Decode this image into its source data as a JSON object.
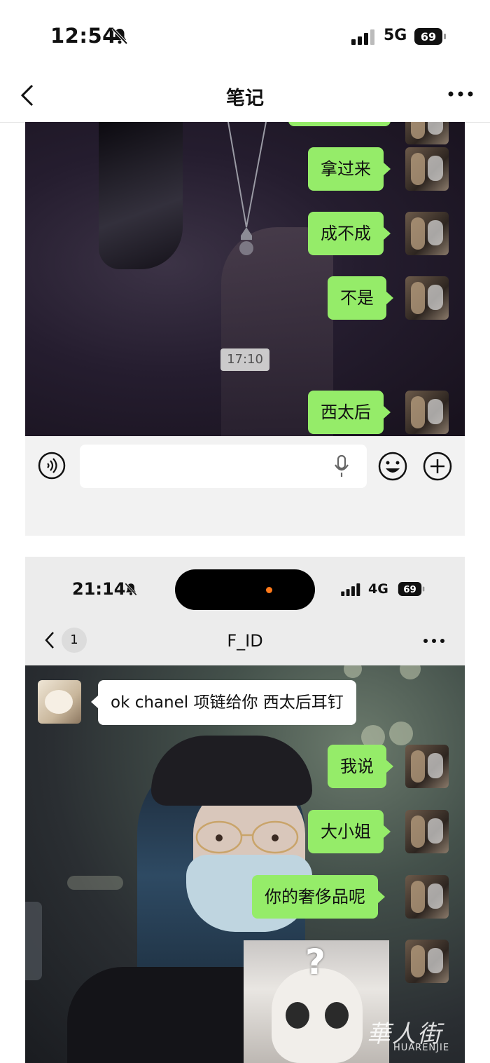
{
  "status_bar": {
    "time": "12:54",
    "network": "5G",
    "battery": "69"
  },
  "nav": {
    "title": "笔记"
  },
  "screenshot1": {
    "messages": [
      {
        "text": "拿过来"
      },
      {
        "text": "成不成"
      },
      {
        "text": "不是"
      },
      {
        "text": "西太后"
      }
    ],
    "timestamp": "17:10"
  },
  "screenshot2": {
    "status_bar": {
      "time": "21:14",
      "network": "4G",
      "battery": "69"
    },
    "nav": {
      "unread_badge": "1",
      "title": "F_ID"
    },
    "messages": [
      {
        "side": "left",
        "text": "ok chanel 项链给你 西太后耳钉"
      },
      {
        "side": "right",
        "text": "我说"
      },
      {
        "side": "right",
        "text": "大小姐"
      },
      {
        "side": "right",
        "text": "你的奢侈品呢"
      }
    ],
    "sticker_text": "?"
  },
  "watermark": {
    "cn": "華人街",
    "en": "HUARENJIE"
  },
  "colors": {
    "bubble_green": "#95ec69",
    "island_dot": "#ff7a1a"
  }
}
